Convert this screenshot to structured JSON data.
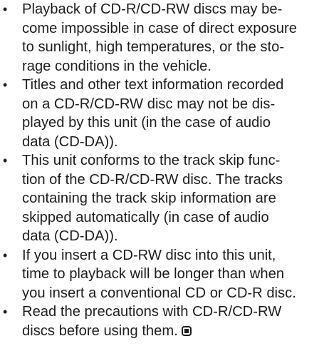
{
  "bullet_symbol": "•",
  "items": [
    {
      "lines": [
        "Playback of CD-R/CD-RW discs may be-",
        "come impossible in case of direct exposure",
        "to sunlight, high temperatures, or the sto-",
        "rage conditions in the vehicle."
      ]
    },
    {
      "lines": [
        "Titles and other text information recorded",
        "on a CD-R/CD-RW disc may not be dis-",
        "played by this unit (in the case of audio",
        "data (CD-DA))."
      ]
    },
    {
      "lines": [
        "This unit conforms to the track skip func-",
        "tion of the CD-R/CD-RW disc. The tracks",
        "containing the track skip information are",
        "skipped automatically (in case of audio",
        "data (CD-DA))."
      ]
    },
    {
      "lines": [
        "If you insert a CD-RW disc into this unit,",
        "time to playback will be longer than when",
        "you insert a conventional CD or CD-R disc."
      ]
    },
    {
      "lines": [
        "Read the precautions with CD-R/CD-RW",
        "discs before using them."
      ]
    }
  ],
  "end_mark_icon": "end-of-section-icon"
}
